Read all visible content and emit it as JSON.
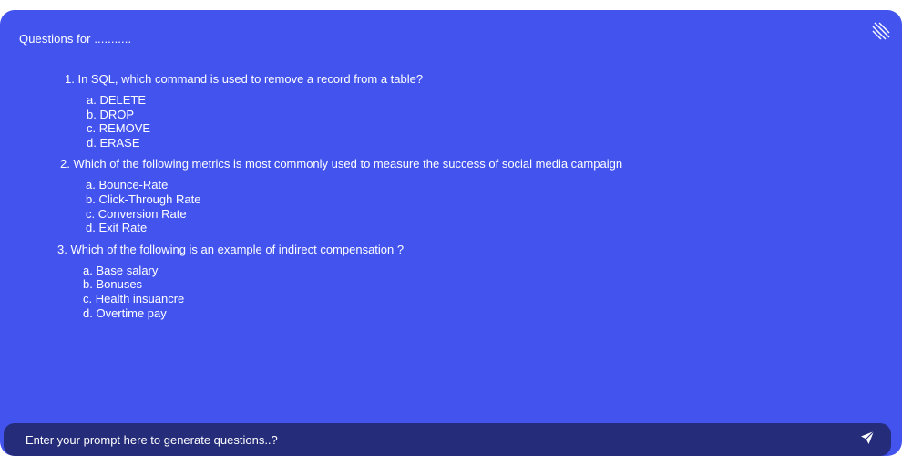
{
  "header": {
    "title": "Questions for ..........."
  },
  "icons": {
    "resize": "resize-handle-icon",
    "send": "send-icon"
  },
  "colors": {
    "panel_background": "#4354ee",
    "prompt_bar_background": "#252c7a",
    "text": "#ffffff"
  },
  "questions": [
    {
      "number": "1. ",
      "text": "In SQL, which command is used to remove a record from a table?",
      "options": [
        "a. DELETE",
        "b. DROP",
        "c. REMOVE",
        "d. ERASE"
      ]
    },
    {
      "number": "2. ",
      "text": "Which of the following metrics is most commonly used to measure the success of social media campaign",
      "options": [
        "a. Bounce-Rate",
        "b. Click-Through Rate",
        "c. Conversion Rate",
        "d. Exit Rate"
      ]
    },
    {
      "number": "3. ",
      "text": "Which of the following is an example of indirect compensation ?",
      "options": [
        "a. Base salary",
        "b. Bonuses",
        "c. Health insuancre",
        "d. Overtime pay"
      ]
    }
  ],
  "prompt": {
    "placeholder": "Enter your prompt here to generate questions..?",
    "value": ""
  }
}
